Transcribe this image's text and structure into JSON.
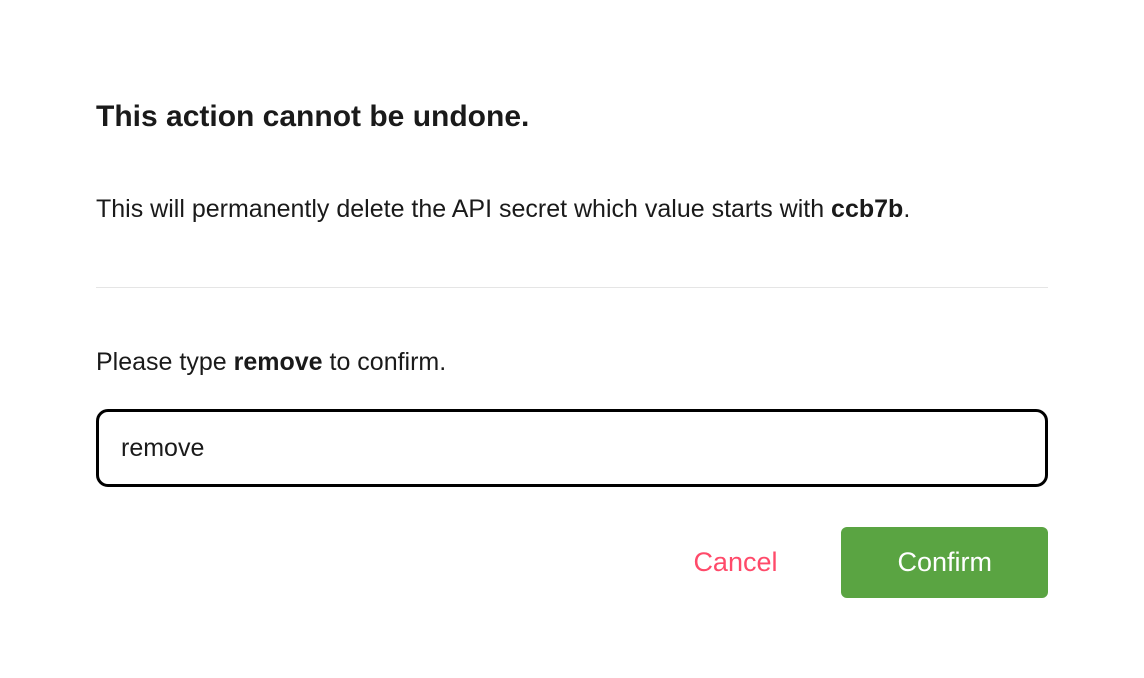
{
  "dialog": {
    "title": "This action cannot be undone.",
    "description_prefix": "This will permanently delete the API secret which value starts with ",
    "description_value": "ccb7b",
    "description_suffix": ".",
    "prompt_prefix": "Please type ",
    "prompt_keyword": "remove",
    "prompt_suffix": " to confirm.",
    "input_value": "remove",
    "cancel_label": "Cancel",
    "confirm_label": "Confirm"
  },
  "colors": {
    "cancel": "#ff4a6a",
    "confirm_bg": "#5aa442"
  }
}
